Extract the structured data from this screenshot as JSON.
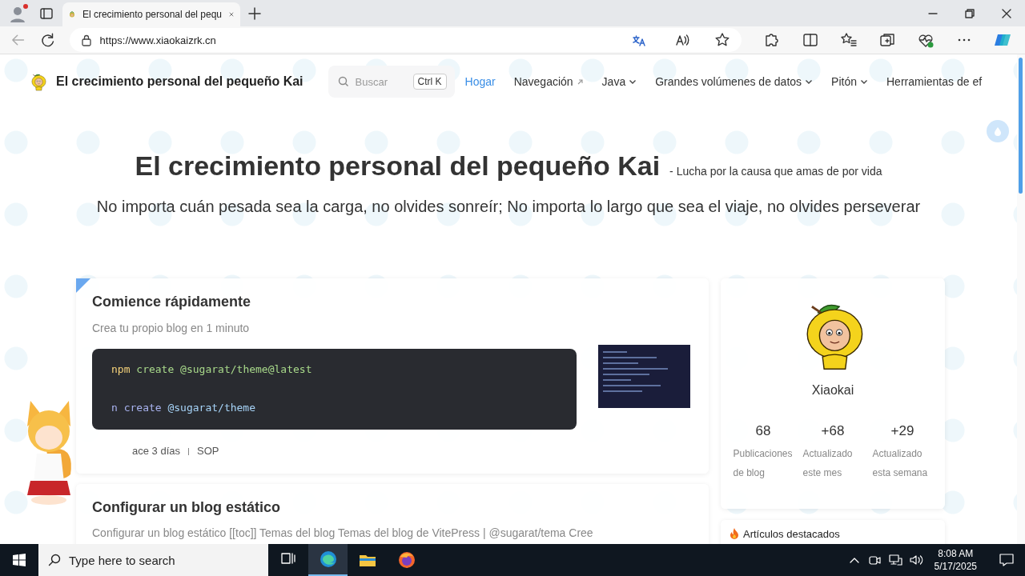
{
  "browser": {
    "tab_title": "El crecimiento personal del pequ",
    "url": "https://www.xiaokaizrk.cn"
  },
  "site": {
    "title": "El crecimiento personal del pequeño Kai",
    "search": {
      "label": "Buscar",
      "shortcut": "Ctrl K"
    },
    "nav": [
      {
        "label": "Hogar",
        "kind": "link",
        "selected": true
      },
      {
        "label": "Navegación",
        "kind": "external",
        "selected": false
      },
      {
        "label": "Java",
        "kind": "dropdown",
        "selected": false
      },
      {
        "label": "Grandes volúmenes de datos",
        "kind": "dropdown",
        "selected": false
      },
      {
        "label": "Pitón",
        "kind": "dropdown",
        "selected": false
      },
      {
        "label": "Herramientas de ef",
        "kind": "link",
        "selected": false
      }
    ]
  },
  "hero": {
    "title": "El crecimiento personal del pequeño Kai",
    "subtitle": "- Lucha por la causa que amas de por vida",
    "tagline": "No importa cuán pesada sea la carga, no olvides sonreír; No importa lo largo que sea el viaje, no olvides perseverar"
  },
  "posts": [
    {
      "kind": "code",
      "title": "Comience rápidamente",
      "description": "Crea tu propio blog en 1 minuto",
      "code": [
        [
          {
            "text": "npm",
            "kind": "command"
          },
          {
            "text": "create",
            "kind": "keyword"
          },
          {
            "text": "@sugarat/theme@latest",
            "kind": "argument"
          }
        ],
        [
          {
            "text": "n",
            "kind": "command"
          },
          {
            "text": "create",
            "kind": "keyword"
          },
          {
            "text": "@sugarat/theme",
            "kind": "argument"
          }
        ]
      ],
      "meta": [
        "ace 3 días",
        "SOP"
      ]
    },
    {
      "kind": "excerpt",
      "title": "Configurar un blog estático",
      "excerpt": "Configurar un blog estático [[toc]] Temas del blog Temas del blog de VitePress | @sugarat/tema Cree"
    }
  ],
  "profile": {
    "name": "Xiaokai",
    "stats": [
      {
        "value": "68",
        "label": "Publicaciones de blog"
      },
      {
        "value": "+68",
        "label": "Actualizado este mes"
      },
      {
        "value": "+29",
        "label": "Actualizado esta semana"
      }
    ]
  },
  "featured": {
    "title": "Artículos destacados"
  },
  "taskbar": {
    "search_placeholder": "Type here to search",
    "apps": [
      {
        "kind": "task-view",
        "selected": false
      },
      {
        "kind": "edge",
        "selected": true
      },
      {
        "kind": "explorer",
        "selected": false
      },
      {
        "kind": "firefox",
        "selected": false
      }
    ],
    "time": "8:08 AM",
    "date": "5/17/2025"
  }
}
